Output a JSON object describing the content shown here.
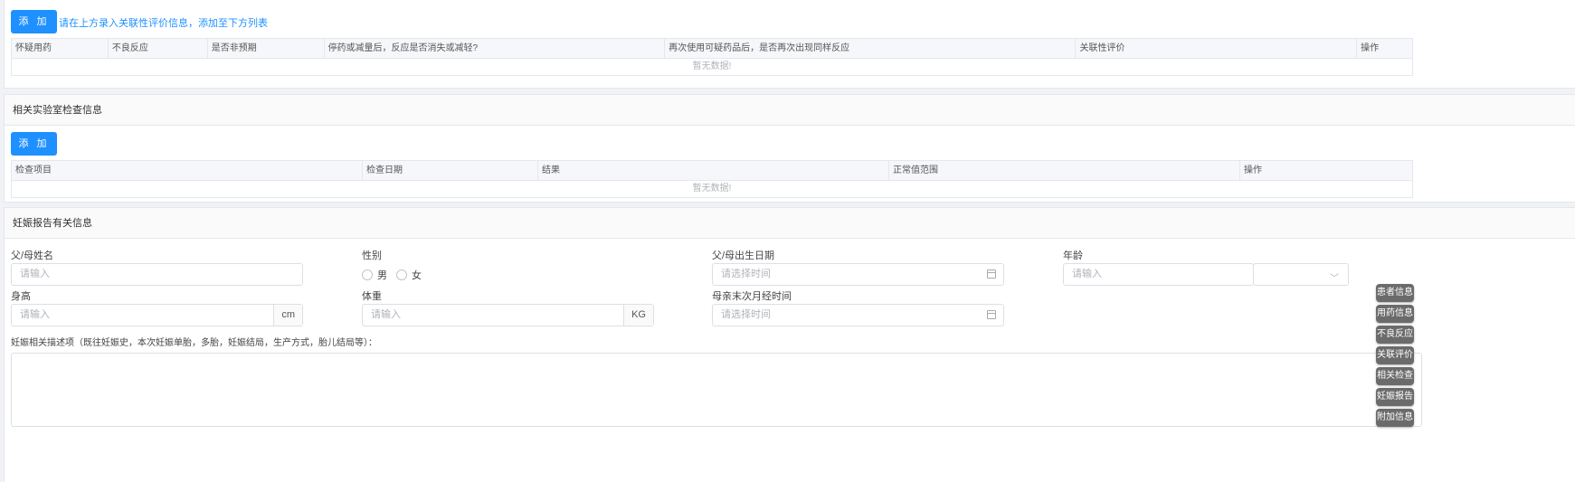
{
  "section1": {
    "add_label": "添 加",
    "hint": "请在上方录入关联性评价信息，添加至下方列表",
    "columns": [
      "怀疑用药",
      "不良反应",
      "是否非预期",
      "停药或减量后，反应是否消失或减轻?",
      "再次使用可疑药品后，是否再次出现同样反应",
      "关联性评价",
      "操作"
    ],
    "empty": "暂无数据!"
  },
  "section2": {
    "title": "相关实验室检查信息",
    "add_label": "添 加",
    "columns": [
      "检查项目",
      "检查日期",
      "结果",
      "正常值范围",
      "操作"
    ],
    "empty": "暂无数据!"
  },
  "section3": {
    "title": "妊娠报告有关信息",
    "parent_name": {
      "label": "父/母姓名",
      "placeholder": "请输入"
    },
    "gender": {
      "label": "性别",
      "options": [
        "男",
        "女"
      ]
    },
    "parent_birth": {
      "label": "父/母出生日期",
      "placeholder": "请选择时间"
    },
    "age": {
      "label": "年龄",
      "placeholder": "请输入",
      "unit_value": ""
    },
    "height": {
      "label": "身高",
      "placeholder": "请输入",
      "unit": "cm"
    },
    "weight": {
      "label": "体重",
      "placeholder": "请输入",
      "unit": "KG"
    },
    "last_period": {
      "label": "母亲末次月经时间",
      "placeholder": "请选择时间"
    },
    "description_label": "妊娠相关描述项（既往妊娠史，本次妊娠单胎，多胎，妊娠结局，生产方式，胎儿结局等）："
  },
  "side_nav": [
    "患者信息",
    "用药信息",
    "不良反应",
    "关联评价",
    "相关检查",
    "妊娠报告",
    "附加信息"
  ]
}
